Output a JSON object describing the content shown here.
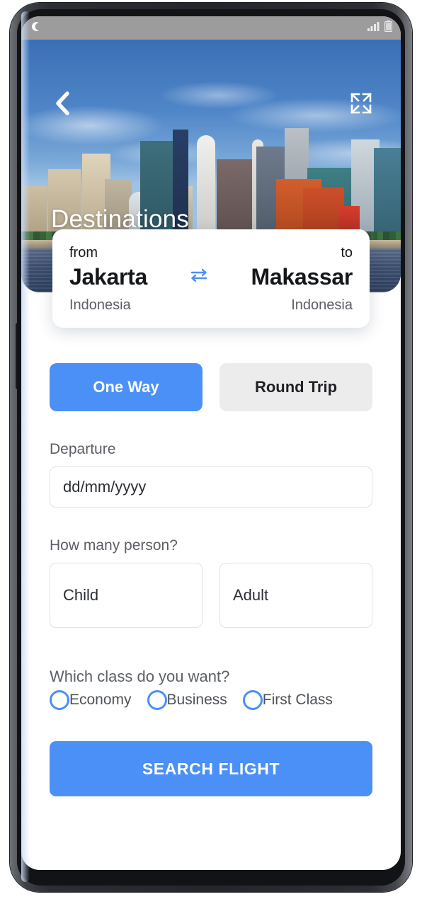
{
  "status_bar": {
    "left_icon": "crescent-moon-icon",
    "signal_icon": "signal-bars-icon",
    "battery_icon": "battery-icon"
  },
  "hero": {
    "title": "Destinations",
    "back_icon": "chevron-left-icon",
    "expand_icon": "expand-fullscreen-icon"
  },
  "destination_card": {
    "from_label": "from",
    "to_label": "to",
    "from_city": "Jakarta",
    "to_city": "Makassar",
    "from_country": "Indonesia",
    "to_country": "Indonesia",
    "swap_icon": "swap-arrows-icon"
  },
  "trip_type": {
    "one_way": "One Way",
    "round_trip": "Round Trip",
    "selected": "One Way"
  },
  "departure": {
    "label": "Departure",
    "placeholder": "dd/mm/yyyy",
    "value": ""
  },
  "passengers": {
    "label": "How many person?",
    "child": "Child",
    "adult": "Adult"
  },
  "travel_class": {
    "label": "Which class do you want?",
    "options": [
      {
        "label": "Economy",
        "selected": false
      },
      {
        "label": "Business",
        "selected": false
      },
      {
        "label": "First Class",
        "selected": false
      }
    ]
  },
  "submit": {
    "label": "SEARCH FLIGHT"
  },
  "colors": {
    "accent_blue": "#4a90f7",
    "inactive_gray": "#ececec",
    "label_gray": "#5c6066",
    "status_bar": "#9c9c9c"
  }
}
